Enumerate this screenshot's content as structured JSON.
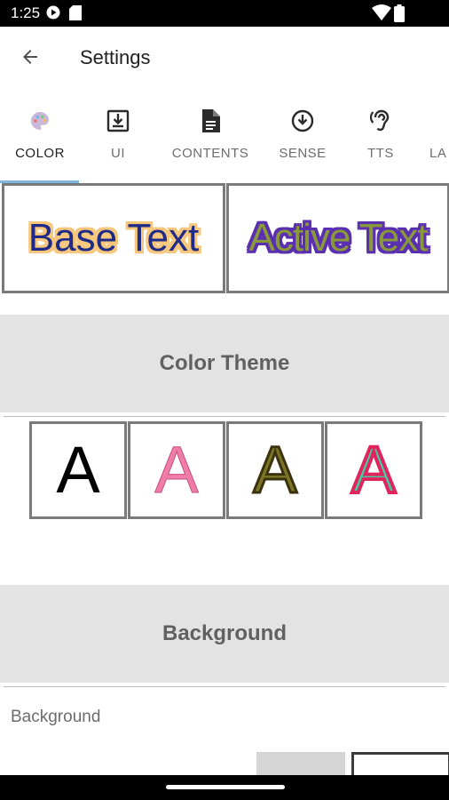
{
  "status_bar": {
    "time": "1:25",
    "icons": [
      "play-store-icon",
      "sd-card-icon",
      "wifi-icon",
      "battery-icon"
    ]
  },
  "app_bar": {
    "title": "Settings",
    "back_icon": "arrow-back-icon"
  },
  "tabs": [
    {
      "label": "COLOR",
      "icon": "palette-icon",
      "active": true
    },
    {
      "label": "UI",
      "icon": "download-box-icon",
      "active": false
    },
    {
      "label": "CONTENTS",
      "icon": "document-icon",
      "active": false
    },
    {
      "label": "SENSE",
      "icon": "download-circle-icon",
      "active": false
    },
    {
      "label": "TTS",
      "icon": "hearing-icon",
      "active": false
    },
    {
      "label": "LA",
      "icon": "",
      "active": false
    }
  ],
  "preview": {
    "base_text": "Base Text",
    "active_text": "Active Text",
    "colors": {
      "base_fill": "#1f2b86",
      "base_outline": "#f6c77c",
      "active_fill": "#8a9a3a",
      "active_outline": "#5a2fb0"
    }
  },
  "sections": {
    "color_theme": "Color Theme",
    "background": "Background"
  },
  "themes": [
    {
      "letter": "A",
      "fill": "#000000",
      "outline": "none"
    },
    {
      "letter": "A",
      "fill": "#f07ca8",
      "outline": "#c4507f"
    },
    {
      "letter": "A",
      "fill": "#7b7524",
      "outline": "#3b3310"
    },
    {
      "letter": "A",
      "fill": "#3fd0a6",
      "outline": "#e0245e"
    }
  ],
  "background": {
    "label": "Background",
    "options": [
      {
        "color": "#d5d5d5"
      },
      {
        "color": "#ffffff"
      }
    ]
  }
}
